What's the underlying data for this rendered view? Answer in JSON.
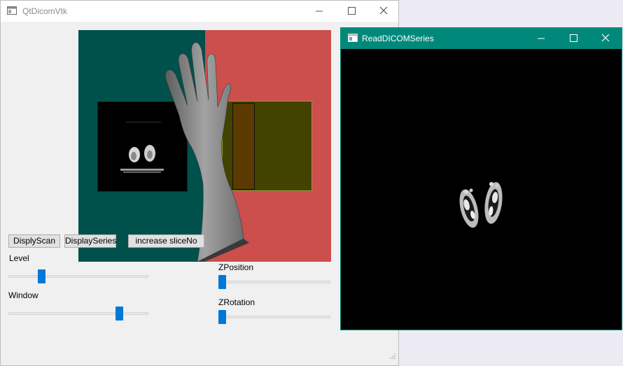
{
  "main_window": {
    "title": "QtDicomVtk",
    "buttons": {
      "display_scan": "DisplyScan",
      "display_series": "DisplaySeries",
      "increase_slice": "increase sliceNo"
    },
    "labels": {
      "level": "Level",
      "window": "Window",
      "z_position": "ZPosition",
      "z_rotation": "ZRotation"
    },
    "sliders": {
      "level": 0.22,
      "window": 0.81,
      "z_position": 0.0,
      "z_rotation": 0.0
    },
    "colors": {
      "viewport_left_bg": "#00504c",
      "viewport_right_bg": "#cc4e4d",
      "overlay_viewport": "#424300",
      "slider_handle": "#0078d7"
    }
  },
  "dicom_window": {
    "title": "ReadDICOMSeries",
    "titlebar_color": "#00897b"
  },
  "icons": {
    "app": "app-window-icon",
    "minimize": "minimize-icon",
    "maximize": "maximize-icon",
    "close": "close-icon",
    "resize": "resize-grip-icon"
  }
}
